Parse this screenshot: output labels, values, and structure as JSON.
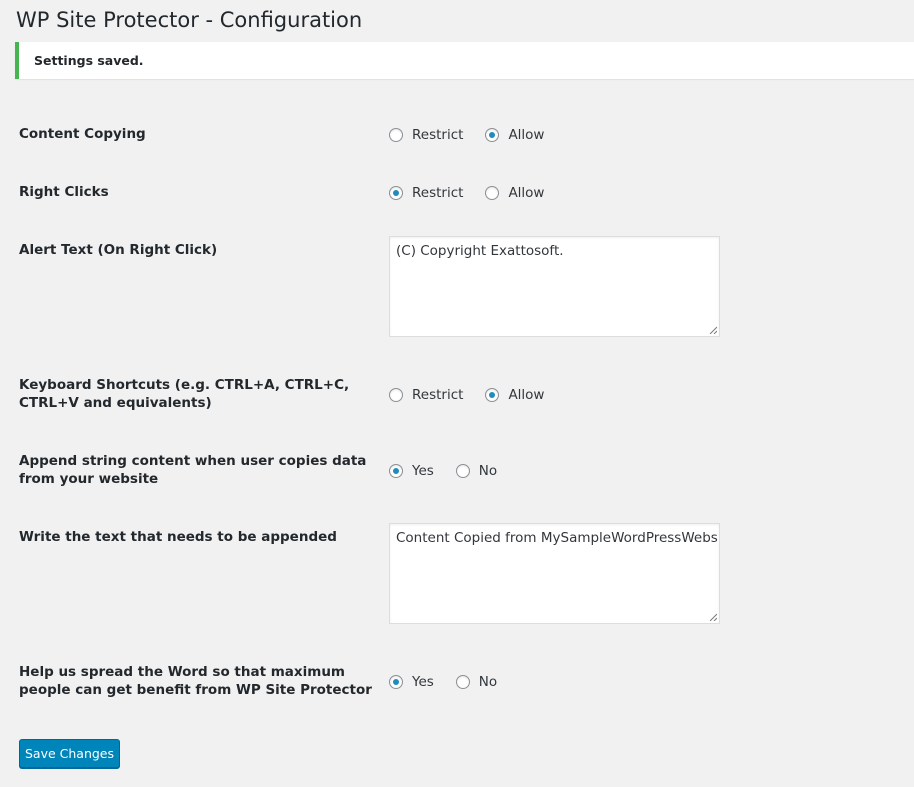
{
  "page": {
    "title": "WP Site Protector - Configuration"
  },
  "notice": {
    "text": "Settings saved."
  },
  "settings": [
    {
      "label": "Content Copying",
      "type": "radio",
      "options": [
        "Restrict",
        "Allow"
      ],
      "selected": "Allow"
    },
    {
      "label": "Right Clicks",
      "type": "radio",
      "options": [
        "Restrict",
        "Allow"
      ],
      "selected": "Restrict"
    },
    {
      "label": "Alert Text (On Right Click)",
      "type": "textarea",
      "value": "(C) Copyright Exattosoft."
    },
    {
      "label": "Keyboard Shortcuts (e.g. CTRL+A, CTRL+C, CTRL+V and equivalents)",
      "type": "radio",
      "options": [
        "Restrict",
        "Allow"
      ],
      "selected": "Allow"
    },
    {
      "label": "Append string content when user copies data from your website",
      "type": "radio",
      "options": [
        "Yes",
        "No"
      ],
      "selected": "Yes"
    },
    {
      "label": "Write the text that needs to be appended",
      "type": "textarea",
      "value": "Content Copied from MySampleWordPressWebsite"
    },
    {
      "label": "Help us spread the Word so that maximum people can get benefit from WP Site Protector",
      "type": "radio",
      "options": [
        "Yes",
        "No"
      ],
      "selected": "Yes"
    }
  ],
  "save_button": {
    "label": "Save Changes"
  },
  "colors": {
    "notice_success_border": "#46b450",
    "primary_button": "#0085ba",
    "radio_checked": "#1e8cbe",
    "background": "#f1f1f1"
  }
}
